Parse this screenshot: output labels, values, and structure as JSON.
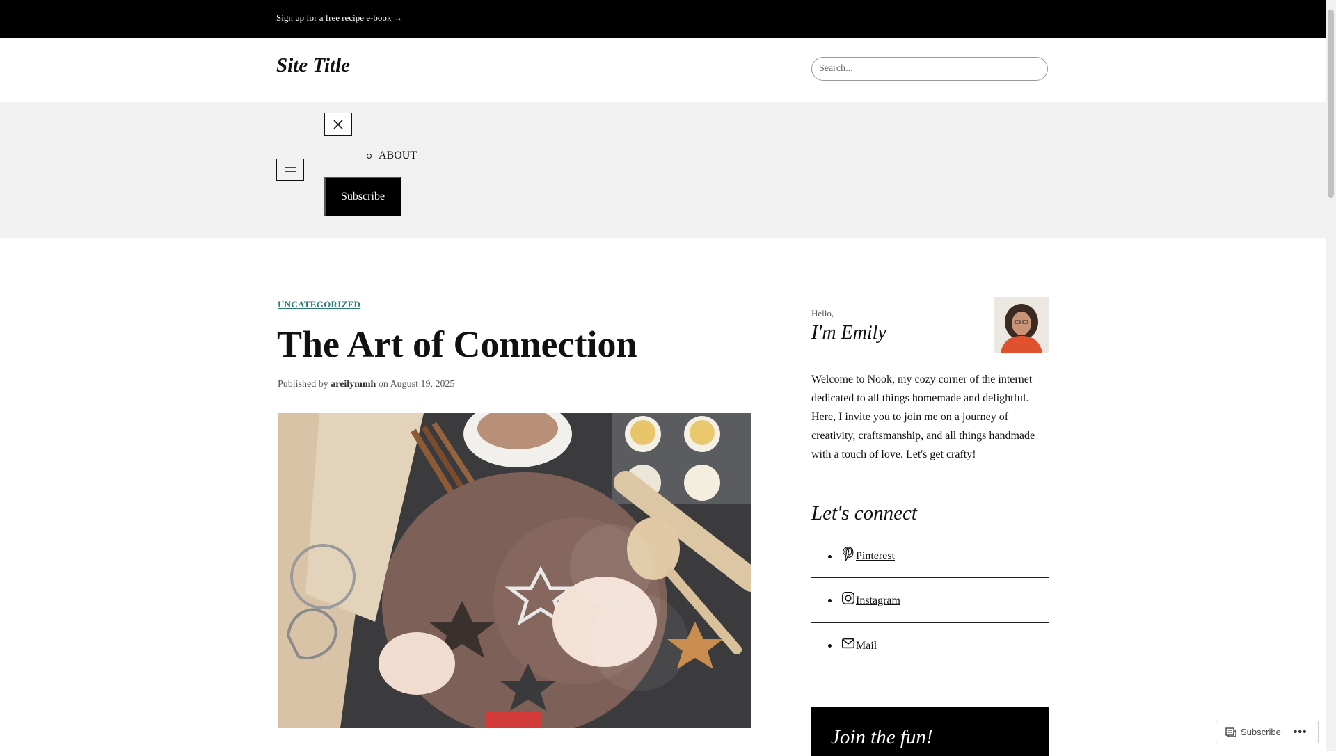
{
  "banner": {
    "link_text": "Sign up for a free recipe e-book →"
  },
  "header": {
    "site_title": "Site Title",
    "search_placeholder": "Search..."
  },
  "nav": {
    "items": [
      {
        "label": "ABOUT"
      }
    ],
    "subscribe_label": "Subscribe",
    "menu_icon": "hamburger-icon",
    "close_icon": "close-icon"
  },
  "post": {
    "category": "UNCATEGORIZED",
    "title": "The Art of Connection",
    "meta_published_by": "Published by",
    "author": "areilymmh",
    "meta_on": "on",
    "date": "August 19, 2025"
  },
  "sidebar": {
    "greeting": "Hello,",
    "name": "I'm Emily",
    "about": "Welcome to Nook, my cozy corner of the internet dedicated to all things homemade and delightful. Here, I invite you to join me on a journey of creativity, craftsmanship, and all things handmade with a touch of love. Let's get crafty!",
    "connect_heading": "Let's connect",
    "social": [
      {
        "label": "Pinterest",
        "icon": "pinterest-icon"
      },
      {
        "label": "Instagram",
        "icon": "instagram-icon"
      },
      {
        "label": "Mail",
        "icon": "mail-icon"
      }
    ],
    "join_heading": "Join the fun!"
  },
  "floating_bar": {
    "subscribe_label": "Subscribe",
    "more_label": "•••"
  },
  "colors": {
    "banner_bg": "#000000",
    "nav_band_bg": "#f1f1f1",
    "category_link": "#2a7a7a",
    "button_bg": "#000000"
  }
}
